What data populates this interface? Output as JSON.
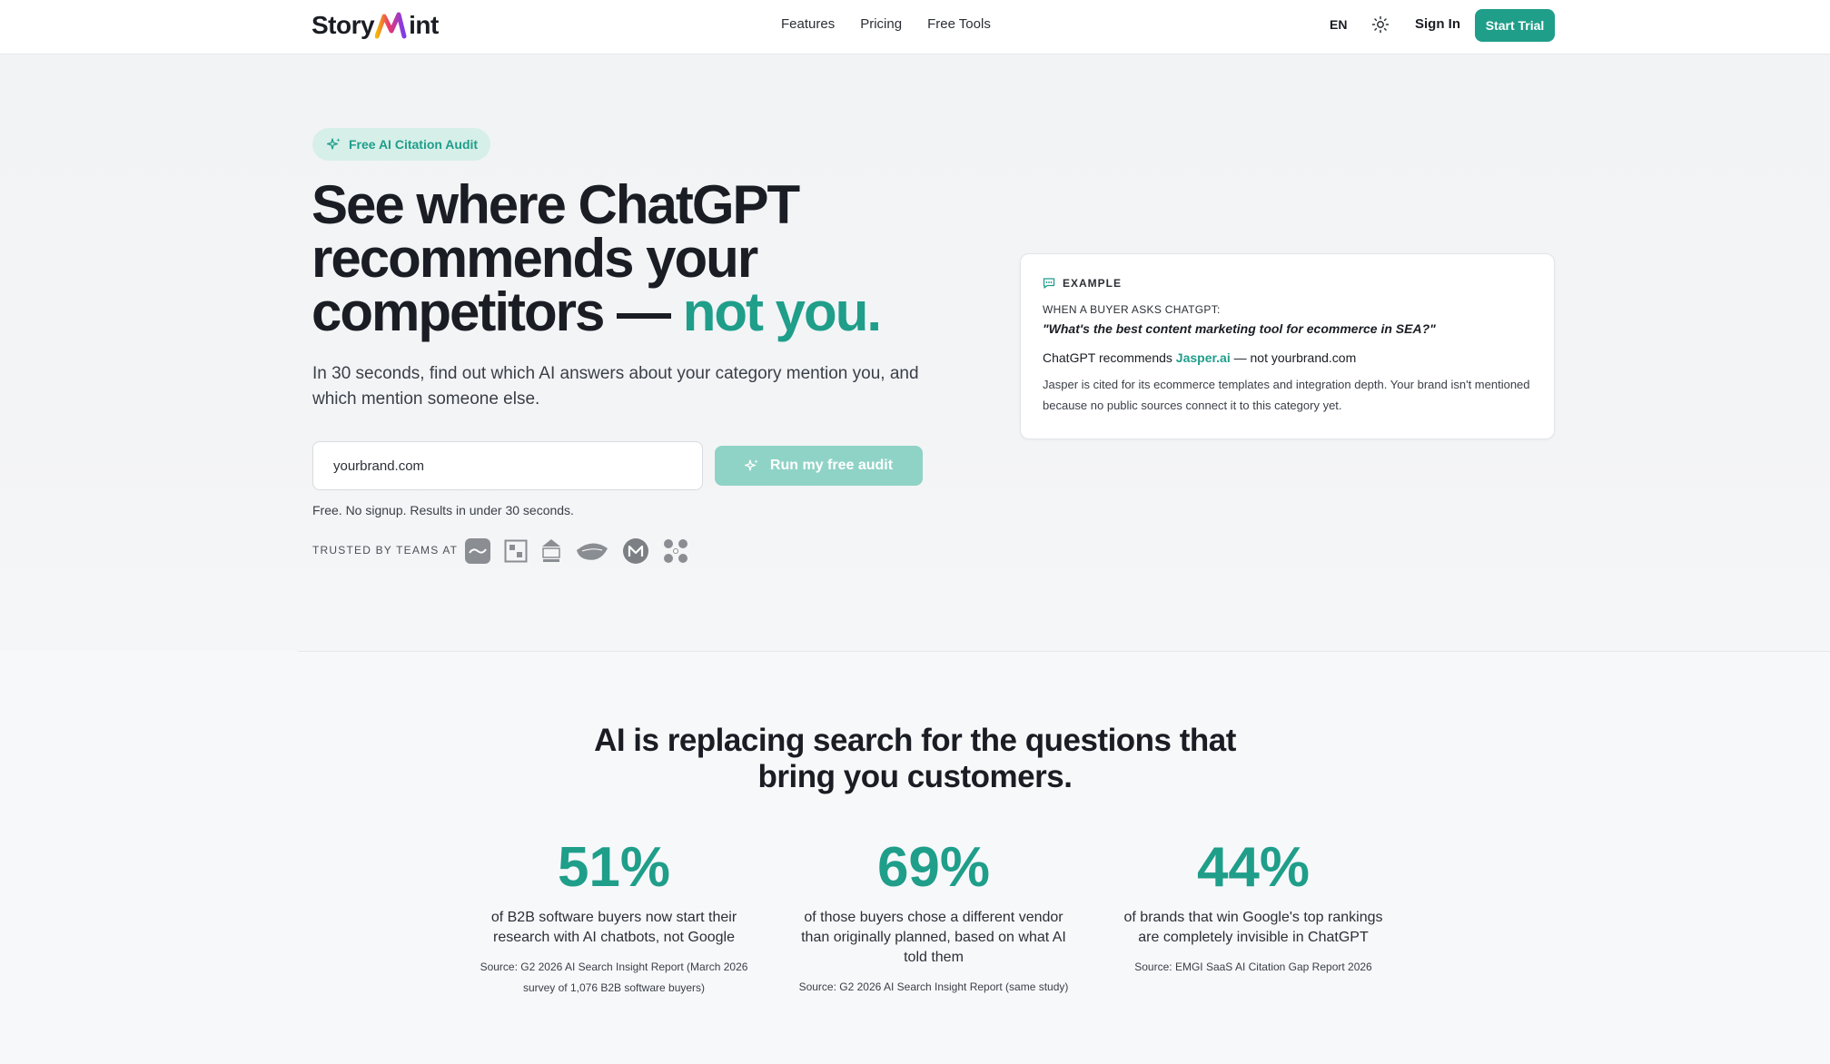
{
  "brand": {
    "name_left": "Story",
    "name_right": "int"
  },
  "nav": {
    "items": [
      "Features",
      "Pricing",
      "Free Tools"
    ]
  },
  "header": {
    "lang": "EN",
    "signin": "Sign In",
    "trial": "Start Trial"
  },
  "hero": {
    "badge": "Free AI Citation Audit",
    "title_main": "See where ChatGPT recommends your competitors —",
    "title_accent": "not you.",
    "subtitle": "In 30 seconds, find out which AI answers about your category mention you, and which mention someone else.",
    "input_value": "yourbrand.com",
    "cta": "Run my free audit",
    "note": "Free. No signup. Results in under 30 seconds.",
    "trusted": "TRUSTED BY TEAMS AT"
  },
  "example": {
    "tag": "EXAMPLE",
    "ask": "WHEN A BUYER ASKS CHATGPT:",
    "question": "\"What's the best content marketing tool for ecommerce in SEA?\"",
    "rec_prefix": "ChatGPT recommends",
    "rec_brand": "Jasper.ai",
    "rec_suffix": "— not yourbrand.com",
    "description": "Jasper is cited for its ecommerce templates and integration depth. Your brand isn't mentioned because no public sources connect it to this category yet."
  },
  "stats": {
    "title_line1": "AI is replacing search for the questions that",
    "title_line2": "bring you customers.",
    "items": [
      {
        "num": "51%",
        "text": "of B2B software buyers now start their research with AI chatbots, not Google",
        "source": "Source: G2 2026 AI Search Insight Report (March 2026 survey of 1,076 B2B software buyers)"
      },
      {
        "num": "69%",
        "text": "of those buyers chose a different vendor than originally planned, based on what AI told them",
        "source": "Source: G2 2026 AI Search Insight Report (same study)"
      },
      {
        "num": "44%",
        "text": "of brands that win Google's top rankings are completely invisible in ChatGPT",
        "source": "Source: EMGI SaaS AI Citation Gap Report 2026"
      }
    ]
  },
  "colors": {
    "accent": "#1f9e8a",
    "accent_soft": "#8fd3c6",
    "pill_bg": "#d7efe9"
  }
}
